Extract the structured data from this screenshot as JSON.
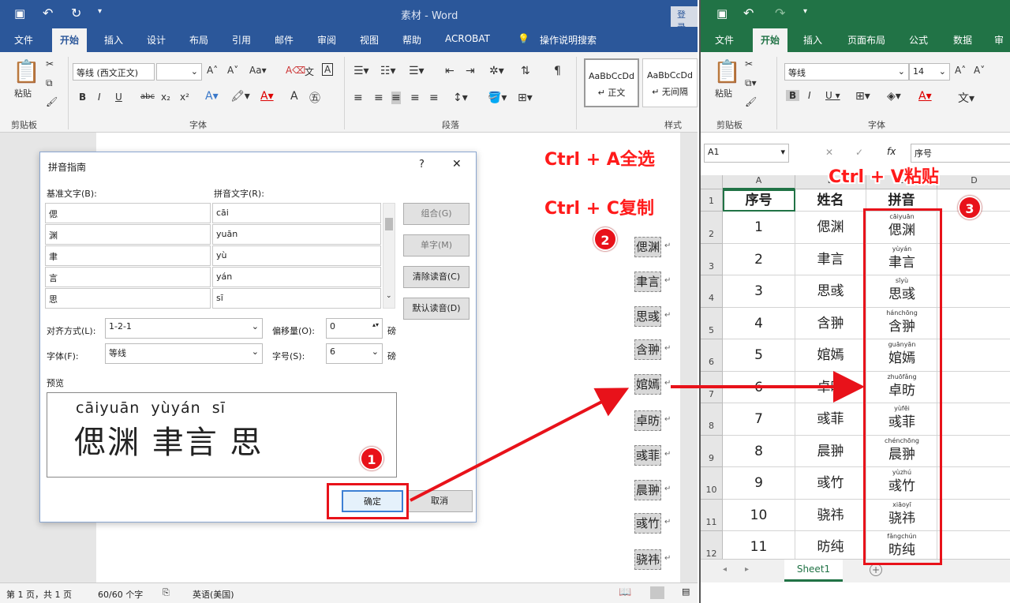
{
  "word": {
    "title": "素材 - Word",
    "signin": "登录",
    "tabs": [
      "文件",
      "开始",
      "插入",
      "设计",
      "布局",
      "引用",
      "邮件",
      "审阅",
      "视图",
      "帮助",
      "ACROBAT",
      "操作说明搜索"
    ],
    "ribbon": {
      "paste": "粘贴",
      "clipboard": "剪贴板",
      "font_name": "等线 (西文正文)",
      "font_group": "字体",
      "paragraph_group": "段落",
      "styles_group": "样式",
      "style1_sample": "AaBbCcDd",
      "style1_name": "↵ 正文",
      "style2_sample": "AaBbCcDd",
      "style2_name": "↵ 无间隔",
      "bold": "B",
      "italic": "I",
      "underline": "U",
      "strike": "abc",
      "sub": "x₂",
      "sup": "x²"
    },
    "status": {
      "page": "第 1 页，共 1 页",
      "words": "60/60 个字",
      "lang": "英语(美国)"
    },
    "doc_chars": [
      "偲渊",
      "聿言",
      "思彧",
      "含翀",
      "婠嫣",
      "卓昉",
      "彧菲",
      "晨翀",
      "彧竹",
      "骁祎"
    ]
  },
  "dialog": {
    "title": "拼音指南",
    "help": "?",
    "close": "✕",
    "base_label": "基准文字(B):",
    "ruby_label": "拼音文字(R):",
    "rows": [
      {
        "base": "偲",
        "ruby": "cāi"
      },
      {
        "base": "渊",
        "ruby": "yuān"
      },
      {
        "base": "聿",
        "ruby": "yù"
      },
      {
        "base": "言",
        "ruby": "yán"
      },
      {
        "base": "思",
        "ruby": "sī"
      }
    ],
    "btn_combine": "组合(G)",
    "btn_single": "单字(M)",
    "btn_clear": "清除读音(C)",
    "btn_default": "默认读音(D)",
    "align_label": "对齐方式(L):",
    "align_value": "1-2-1",
    "offset_label": "偏移量(O):",
    "offset_value": "0",
    "offset_unit": "磅",
    "font_label": "字体(F):",
    "font_value": "等线",
    "size_label": "字号(S):",
    "size_value": "6",
    "size_unit": "磅",
    "preview_label": "预览",
    "preview_pinyin": "cāiyuān  yùyán  sī",
    "preview_chars": "偲渊 聿言 思",
    "ok": "确定",
    "cancel": "取消"
  },
  "excel": {
    "tabs": [
      "文件",
      "开始",
      "插入",
      "页面布局",
      "公式",
      "数据",
      "审"
    ],
    "paste": "粘贴",
    "clipboard": "剪贴板",
    "font_name": "等线",
    "font_size": "14",
    "font_group": "字体",
    "namebox": "A1",
    "fx_value": "序号",
    "columns": [
      "A",
      "B",
      "C",
      "D"
    ],
    "headers": [
      "序号",
      "姓名",
      "拼音"
    ],
    "rows": [
      {
        "n": "1",
        "name": "偲渊",
        "py": "cāiyuān",
        "pc": "偲渊"
      },
      {
        "n": "2",
        "name": "聿言",
        "py": "yùyán",
        "pc": "聿言"
      },
      {
        "n": "3",
        "name": "思彧",
        "py": "sīyù",
        "pc": "思彧"
      },
      {
        "n": "4",
        "name": "含翀",
        "py": "hánchōng",
        "pc": "含翀"
      },
      {
        "n": "5",
        "name": "婠嫣",
        "py": "guānyān",
        "pc": "婠嫣"
      },
      {
        "n": "6",
        "name": "卓昉",
        "py": "zhuōfǎng",
        "pc": "卓昉"
      },
      {
        "n": "7",
        "name": "彧菲",
        "py": "yùfēi",
        "pc": "彧菲"
      },
      {
        "n": "8",
        "name": "晨翀",
        "py": "chénchōng",
        "pc": "晨翀"
      },
      {
        "n": "9",
        "name": "彧竹",
        "py": "yùzhú",
        "pc": "彧竹"
      },
      {
        "n": "10",
        "name": "骁祎",
        "py": "xiāoyī",
        "pc": "骁祎"
      },
      {
        "n": "11",
        "name": "昉纯",
        "py": "fǎngchún",
        "pc": "昉纯"
      }
    ],
    "sheet_tab": "Sheet1"
  },
  "annotations": {
    "ctrl_a": "Ctrl + A全选",
    "ctrl_c": "Ctrl + C复制",
    "ctrl_v": "Ctrl + V粘贴",
    "step1": "1",
    "step2": "2",
    "step3": "3"
  },
  "colors": {
    "word_blue": "#2b579a",
    "excel_green": "#217346",
    "annotation_red": "#e8121a"
  }
}
